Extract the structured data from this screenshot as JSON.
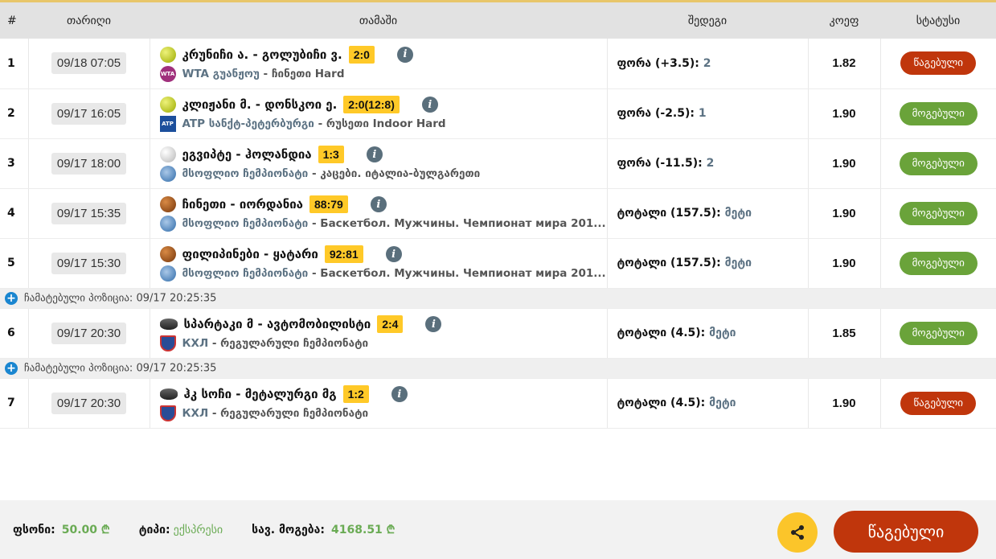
{
  "header": {
    "num": "#",
    "date": "თარიღი",
    "game": "თამაში",
    "result": "შედეგი",
    "coef": "კოეფ",
    "status": "სტატუსი"
  },
  "rows": [
    {
      "num": "1",
      "date": "09/18 07:05",
      "sport": "tennis",
      "teams": "კრუნიჩი ა. - გოლუბიჩი ვ.",
      "score": "2:0",
      "league_icon": "wta",
      "league_text": "WTA",
      "league": "WTA გუანჟოუ",
      "tournament": " - ჩინეთი Hard",
      "result": "ფორა (+3.5): ",
      "result_value": "2",
      "coef": "1.82",
      "status": "წაგებული",
      "status_type": "lost"
    },
    {
      "num": "2",
      "date": "09/17 16:05",
      "sport": "tennis",
      "teams": "კლიჟანი მ. - დონსკოი ე.",
      "score": "2:0(12:8)",
      "league_icon": "atp",
      "league_text": "ATP",
      "league": "ATP სანქტ-პეტერბურგი",
      "tournament": " - რუსეთი Indoor Hard",
      "result": "ფორა (-2.5): ",
      "result_value": "1",
      "coef": "1.90",
      "status": "მოგებული",
      "status_type": "won"
    },
    {
      "num": "3",
      "date": "09/17 18:00",
      "sport": "volley",
      "teams": "ეგვიპტე - ჰოლანდია",
      "score": "1:3",
      "league_icon": "fiba",
      "league_text": "",
      "league": "მსოფლიო ჩემპიონატი",
      "tournament": " - კაცები. იტალია-ბულგარეთი",
      "result": "ფორა (-11.5): ",
      "result_value": "2",
      "coef": "1.90",
      "status": "მოგებული",
      "status_type": "won"
    },
    {
      "num": "4",
      "date": "09/17 15:35",
      "sport": "basket",
      "teams": "ჩინეთი - იორდანია",
      "score": "88:79",
      "league_icon": "fiba",
      "league_text": "",
      "league": "მსოფლიო ჩემპიონატი",
      "tournament": " - Баскетбол. Мужчины. Чемпионат мира 201...",
      "result": "ტოტალი (157.5): ",
      "result_value": "მეტი",
      "coef": "1.90",
      "status": "მოგებული",
      "status_type": "won"
    },
    {
      "num": "5",
      "date": "09/17 15:30",
      "sport": "basket",
      "teams": "ფილიპინები - ყატარი",
      "score": "92:81",
      "league_icon": "fiba",
      "league_text": "",
      "league": "მსოფლიო ჩემპიონატი",
      "tournament": " - Баскетбол. Мужчины. Чемпионат мира 201...",
      "result": "ტოტალი (157.5): ",
      "result_value": "მეტი",
      "coef": "1.90",
      "status": "მოგებული",
      "status_type": "won"
    },
    {
      "sep": "ჩამატებული პოზიცია: 09/17 20:25:35"
    },
    {
      "num": "6",
      "date": "09/17 20:30",
      "sport": "puck",
      "teams": "სპარტაკი მ - ავტომობილისტი",
      "score": "2:4",
      "league_icon": "khl",
      "league_text": "",
      "league": "КХЛ",
      "tournament": " - რეგულარული ჩემპიონატი",
      "result": "ტოტალი (4.5): ",
      "result_value": "მეტი",
      "coef": "1.85",
      "status": "მოგებული",
      "status_type": "won"
    },
    {
      "sep": "ჩამატებული პოზიცია: 09/17 20:25:35"
    },
    {
      "num": "7",
      "date": "09/17 20:30",
      "sport": "puck",
      "teams": "ჰკ სოჩი - მეტალურგი მგ",
      "score": "1:2",
      "league_icon": "khl",
      "league_text": "",
      "league": "КХЛ",
      "tournament": " - რეგულარული ჩემპიონატი",
      "result": "ტოტალი (4.5): ",
      "result_value": "მეტი",
      "coef": "1.90",
      "status": "წაგებული",
      "status_type": "lost"
    }
  ],
  "footer": {
    "stake_label": "ფსონი:",
    "stake": "50.00 ₾",
    "type_label": "ტიპი:",
    "type": "ექსპრესი",
    "win_label": "სავ. მოგება:",
    "win": "4168.51 ₾",
    "status_button": "წაგებული"
  },
  "colors": {
    "lost": "#c0360c",
    "won": "#6aa33a",
    "score": "#ffc928",
    "accent": "#e8c66a"
  }
}
